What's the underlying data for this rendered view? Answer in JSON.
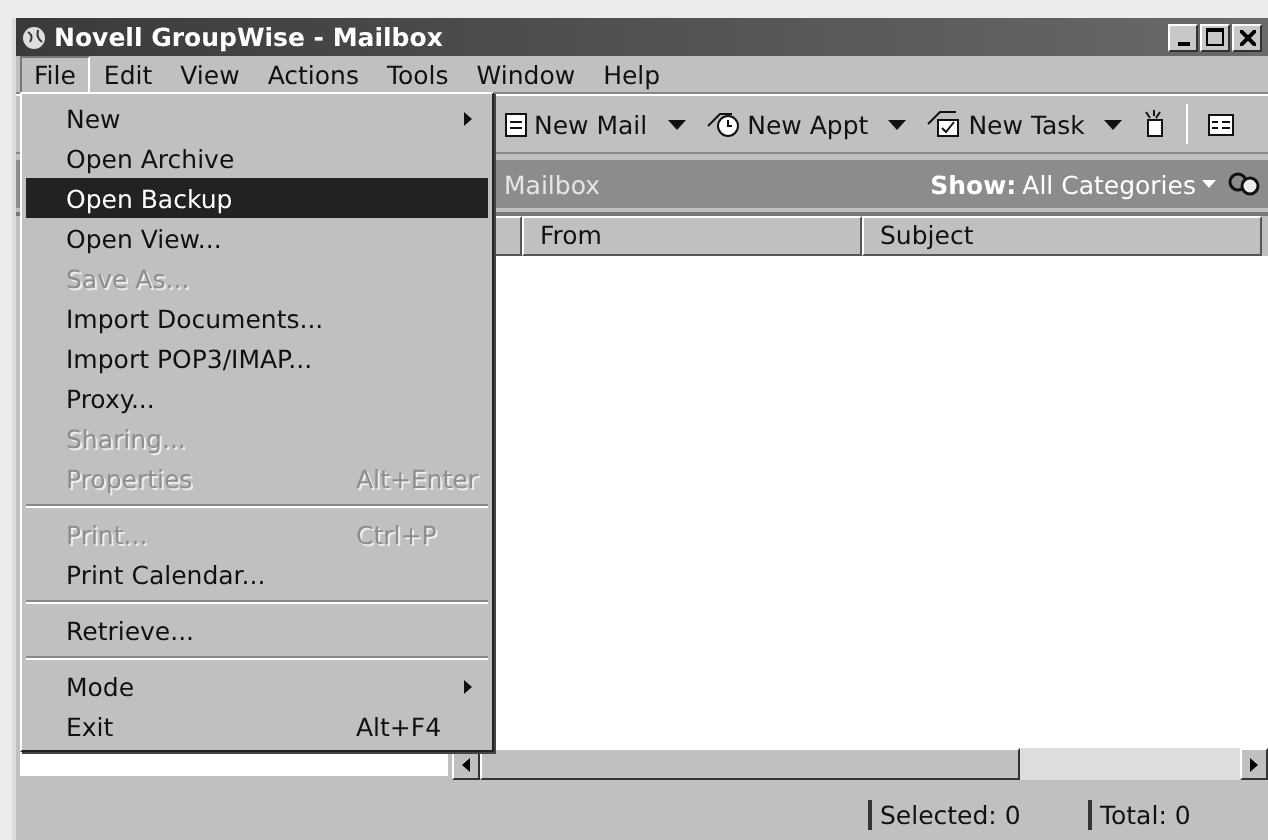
{
  "window": {
    "title": "Novell GroupWise - Mailbox"
  },
  "menubar": [
    {
      "label": "File",
      "selected": true
    },
    {
      "label": "Edit",
      "selected": false
    },
    {
      "label": "View",
      "selected": false
    },
    {
      "label": "Actions",
      "selected": false
    },
    {
      "label": "Tools",
      "selected": false
    },
    {
      "label": "Window",
      "selected": false
    },
    {
      "label": "Help",
      "selected": false
    }
  ],
  "toolbar": [
    {
      "label": "New Mail"
    },
    {
      "label": "New Appt"
    },
    {
      "label": "New Task"
    }
  ],
  "folder_header": {
    "title": "Mailbox",
    "show_label": "Show:",
    "show_value": "All Categories"
  },
  "columns": [
    "From",
    "Subject"
  ],
  "status_bar": [
    "Selected: 0",
    "Total: 0"
  ],
  "file_menu": [
    {
      "kind": "item",
      "label": "New",
      "submenu": true,
      "disabled": false,
      "selected": false
    },
    {
      "kind": "item",
      "label": "Open Archive",
      "disabled": false,
      "selected": false
    },
    {
      "kind": "item",
      "label": "Open Backup",
      "disabled": false,
      "selected": true
    },
    {
      "kind": "item",
      "label": "Open View...",
      "disabled": false,
      "selected": false
    },
    {
      "kind": "item",
      "label": "Save As...",
      "disabled": true,
      "selected": false
    },
    {
      "kind": "item",
      "label": "Import Documents...",
      "disabled": false,
      "selected": false
    },
    {
      "kind": "item",
      "label": "Import POP3/IMAP...",
      "disabled": false,
      "selected": false
    },
    {
      "kind": "item",
      "label": "Proxy...",
      "disabled": false,
      "selected": false
    },
    {
      "kind": "item",
      "label": "Sharing...",
      "disabled": true,
      "selected": false
    },
    {
      "kind": "item",
      "label": "Properties",
      "shortcut": "Alt+Enter",
      "disabled": true,
      "selected": false
    },
    {
      "kind": "separator"
    },
    {
      "kind": "item",
      "label": "Print...",
      "shortcut": "Ctrl+P",
      "disabled": true,
      "selected": false
    },
    {
      "kind": "item",
      "label": "Print Calendar...",
      "disabled": false,
      "selected": false
    },
    {
      "kind": "separator"
    },
    {
      "kind": "item",
      "label": "Retrieve...",
      "disabled": false,
      "selected": false
    },
    {
      "kind": "separator"
    },
    {
      "kind": "item",
      "label": "Mode",
      "submenu": true,
      "disabled": false,
      "selected": false
    },
    {
      "kind": "item",
      "label": "Exit",
      "shortcut": "Alt+F4",
      "disabled": false,
      "selected": false
    }
  ]
}
